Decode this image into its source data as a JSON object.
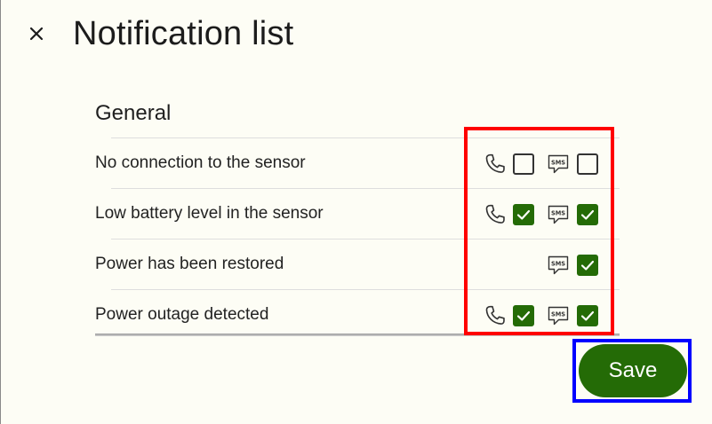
{
  "header": {
    "close_icon": "close-icon",
    "title": "Notification list"
  },
  "section": {
    "title": "General"
  },
  "rows": [
    {
      "label": "No connection to the sensor",
      "phone": false,
      "sms": false,
      "has_phone": true
    },
    {
      "label": "Low battery level in the sensor",
      "phone": true,
      "sms": true,
      "has_phone": true
    },
    {
      "label": "Power has been restored",
      "phone": null,
      "sms": true,
      "has_phone": false
    },
    {
      "label": "Power outage detected",
      "phone": true,
      "sms": true,
      "has_phone": true
    }
  ],
  "icons": {
    "phone": "phone-icon",
    "sms": "sms-icon",
    "check": "check-icon"
  },
  "sms_icon_text": "SMS",
  "footer": {
    "save_label": "Save"
  },
  "colors": {
    "accent": "#246b06",
    "background": "#fdfdf5",
    "highlight_red": "#ff0000",
    "highlight_blue": "#0000ff"
  }
}
